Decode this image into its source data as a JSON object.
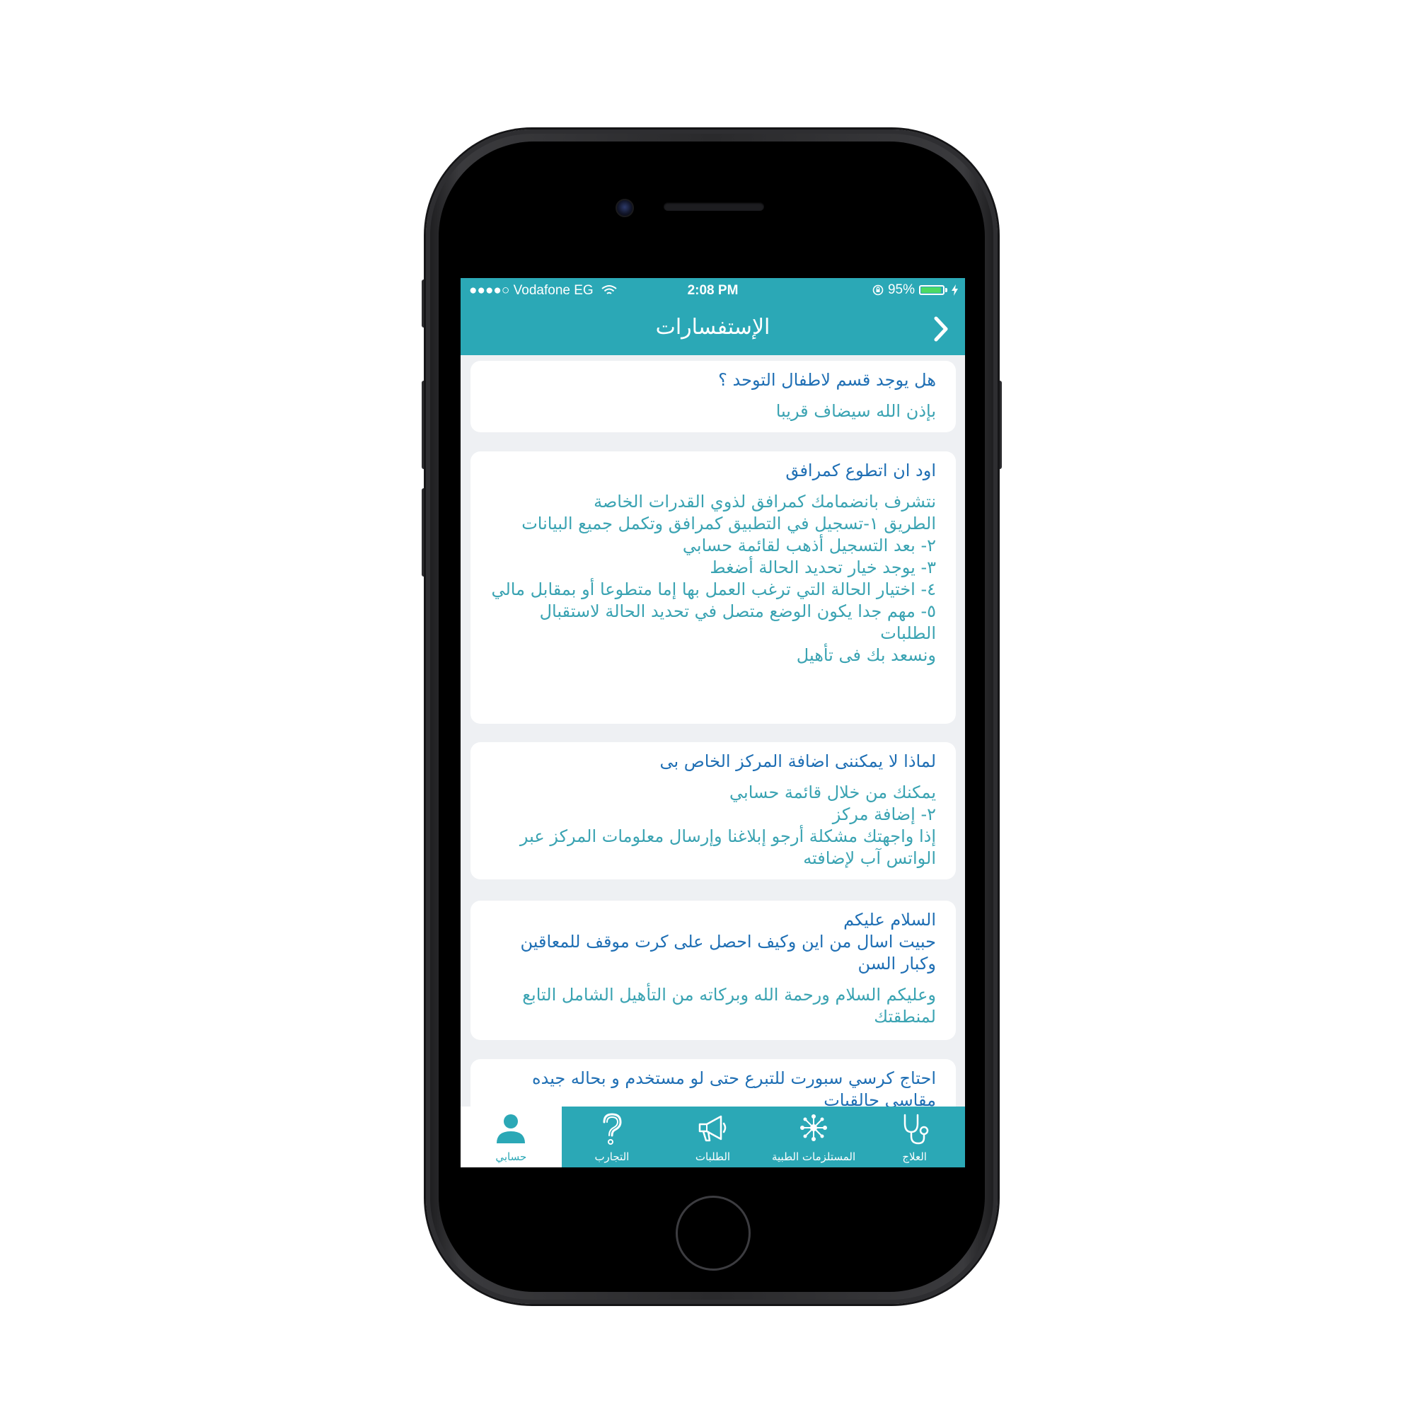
{
  "status_bar": {
    "carrier": "●●●●○ Vodafone EG",
    "time": "2:08 PM",
    "battery": "95%",
    "battery_level": 0.95
  },
  "nav": {
    "title": "الإستفسارات",
    "back_icon": "chevron-right-icon"
  },
  "faq": [
    {
      "question": [
        "هل يوجد قسم لاطفال التوحد ؟"
      ],
      "answer": [
        "بإذن الله سيضاف قريبا"
      ]
    },
    {
      "question": [
        "اود ان اتطوع كمرافق"
      ],
      "answer": [
        "نتشرف بانضمامك كمرافق لذوي القدرات الخاصة",
        "الطريق ١-تسجيل في التطبيق كمرافق وتكمل جميع البيانات",
        "٢- بعد التسجيل أذهب لقائمة حسابي",
        "٣- يوجد خيار تحديد الحالة أضغط",
        "٤- اختيار الحالة التي ترغب العمل بها إما متطوعا أو بمقابل مالي",
        "٥- مهم جدا يكون الوضع متصل في تحديد الحالة لاستقبال الطلبات",
        "ونسعد بك فى تأهيل"
      ]
    },
    {
      "question": [
        "لماذا لا يمكننى اضافة المركز الخاص بى"
      ],
      "answer": [
        "يمكنك من خلال قائمة حسابي",
        "٢- إضافة مركز",
        "إذا واجهتك مشكلة أرجو إبلاغنا وإرسال معلومات المركز عبر الواتس آب لإضافته"
      ]
    },
    {
      "question": [
        "السلام عليكم",
        "حبيت اسال من اين وكيف احصل على كرت موقف للمعاقين وكبار السن"
      ],
      "answer": [
        "وعليكم السلام ورحمة الله وبركاته من التأهيل الشامل التابع لمنطقتك"
      ]
    },
    {
      "question": [
        "احتاج كرسي سبورت للتبرع حتى لو مستخدم و بحاله جيده مقاسي حالقيات"
      ],
      "answer": []
    }
  ],
  "tabs": [
    {
      "label": "حسابي",
      "icon": "user-icon",
      "active": true
    },
    {
      "label": "التجارب",
      "icon": "question-icon",
      "active": false
    },
    {
      "label": "الطلبات",
      "icon": "megaphone-icon",
      "active": false
    },
    {
      "label": "المستلزمات الطبية",
      "icon": "network-icon",
      "active": false
    },
    {
      "label": "العلاج",
      "icon": "stethoscope-icon",
      "active": false
    }
  ],
  "colors": {
    "primary": "#2ba8b6",
    "question_text": "#1f6fb4",
    "answer_text": "#3aa3b2",
    "background": "#eef0f3"
  }
}
